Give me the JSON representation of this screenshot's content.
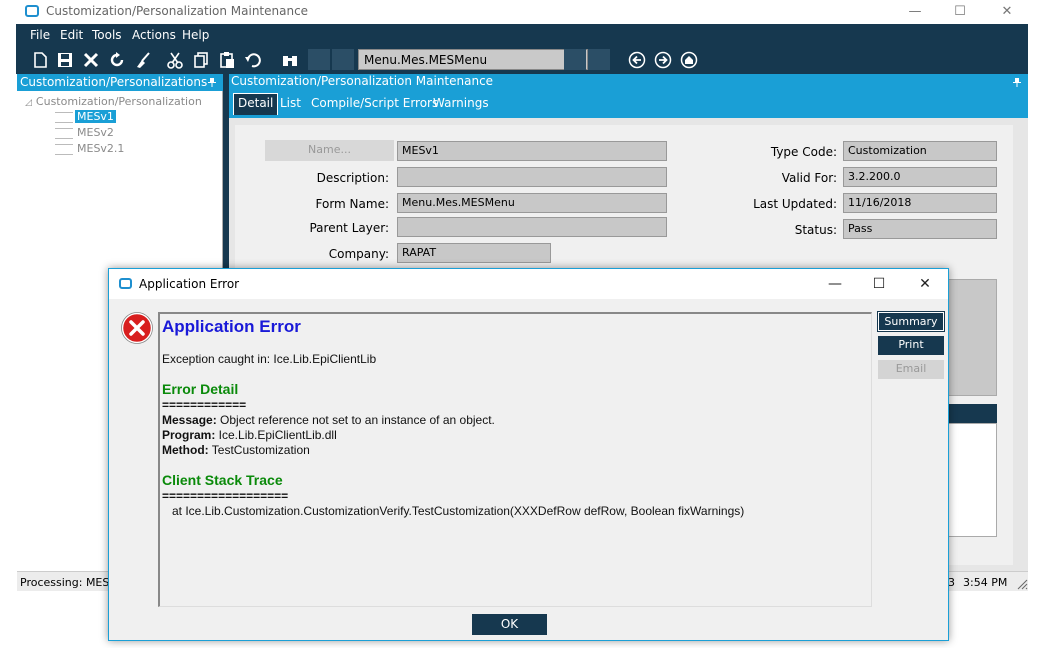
{
  "main_window": {
    "title": "Customization/Personalization Maintenance",
    "controls": {
      "minimize": "—",
      "maximize": "☐",
      "close": "✕"
    }
  },
  "menu": [
    "File",
    "Edit",
    "Tools",
    "Actions",
    "Help"
  ],
  "toolbar": {
    "icons": [
      "new-icon",
      "save-icon",
      "delete-icon",
      "refresh-icon",
      "clear-icon",
      "cut-icon",
      "copy-icon",
      "paste-icon",
      "undo-icon",
      "search-icon"
    ],
    "combo_value": "Menu.Mes.MESMenu"
  },
  "left_panel": {
    "header": "Customization/Personalizations",
    "tree_root": "Customization/Personalization",
    "items": [
      {
        "label": "MESv1",
        "selected": true
      },
      {
        "label": "MESv2",
        "selected": false
      },
      {
        "label": "MESv2.1",
        "selected": false
      }
    ]
  },
  "right_panel": {
    "header": "Customization/Personalization Maintenance",
    "tabs": [
      "Detail",
      "List",
      "Compile/Script Errors",
      "Warnings"
    ],
    "form": {
      "name_button": "Name...",
      "name_value": "MESv1",
      "description_label": "Description:",
      "description_value": "",
      "form_name_label": "Form Name:",
      "form_name_value": "Menu.Mes.MESMenu",
      "parent_layer_label": "Parent Layer:",
      "parent_layer_value": "",
      "company_label": "Company:",
      "company_value": "RAPAT",
      "type_code_label": "Type Code:",
      "type_code_value": "Customization",
      "valid_for_label": "Valid For:",
      "valid_for_value": "3.2.200.0",
      "last_updated_label": "Last Updated:",
      "last_updated_value": "11/16/2018",
      "status_label": "Status:",
      "status_value": "Pass"
    }
  },
  "status_bar": {
    "left": "Processing: MES",
    "mid": "3",
    "time": "3:54 PM"
  },
  "dialog": {
    "title": "Application Error",
    "controls": {
      "minimize": "—",
      "maximize": "☐",
      "close": "✕"
    },
    "heading": "Application Error",
    "exception": "Exception caught in: Ice.Lib.EpiClientLib",
    "detail_heading": "Error Detail",
    "detail_rule": "============",
    "message_label": "Message:",
    "message_value": " Object reference not set to an instance of an object.",
    "program_label": "Program:",
    "program_value": " Ice.Lib.EpiClientLib.dll",
    "method_label": "Method:",
    "method_value": " TestCustomization",
    "trace_heading": "Client Stack Trace",
    "trace_rule": "==================",
    "trace_line": "   at Ice.Lib.Customization.CustomizationVerify.TestCustomization(XXXDefRow defRow, Boolean fixWarnings)",
    "buttons": {
      "summary": "Summary",
      "print": "Print",
      "email": "Email",
      "ok": "OK"
    }
  },
  "colors": {
    "navy": "#16384f",
    "accent": "#1a9fd6",
    "error_red": "#d81e1e",
    "heading_blue": "#1919d8",
    "heading_green": "#0a8a0a"
  }
}
